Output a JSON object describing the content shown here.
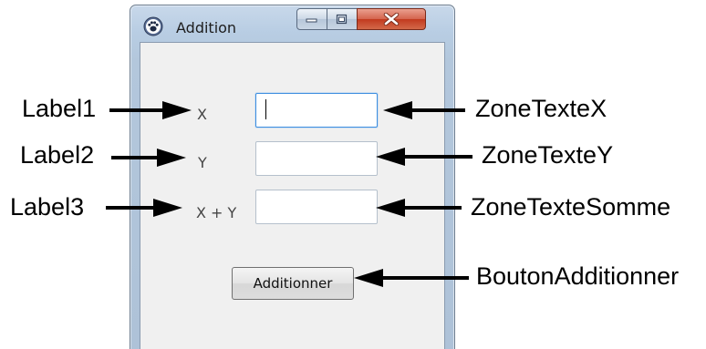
{
  "window": {
    "title": "Addition",
    "app_icon": "paw-icon",
    "caption_buttons": [
      "minimize-icon",
      "maximize-icon",
      "close-icon"
    ]
  },
  "form": {
    "labels": {
      "x": "X",
      "y": "Y",
      "sum": "X + Y"
    },
    "fields": {
      "x_value": "",
      "y_value": "",
      "sum_value": ""
    },
    "button_label": "Additionner"
  },
  "annotations": {
    "left": [
      "Label1",
      "Label2",
      "Label3"
    ],
    "right": [
      "ZoneTexteX",
      "ZoneTexteY",
      "ZoneTexteSomme",
      "BoutonAdditionner"
    ]
  },
  "colors": {
    "window_frame": "#b8cde3",
    "client_background": "#f0f0f0",
    "close_button": "#c23b1f",
    "focus_border": "#3d8ee0",
    "arrow": "#000000"
  }
}
